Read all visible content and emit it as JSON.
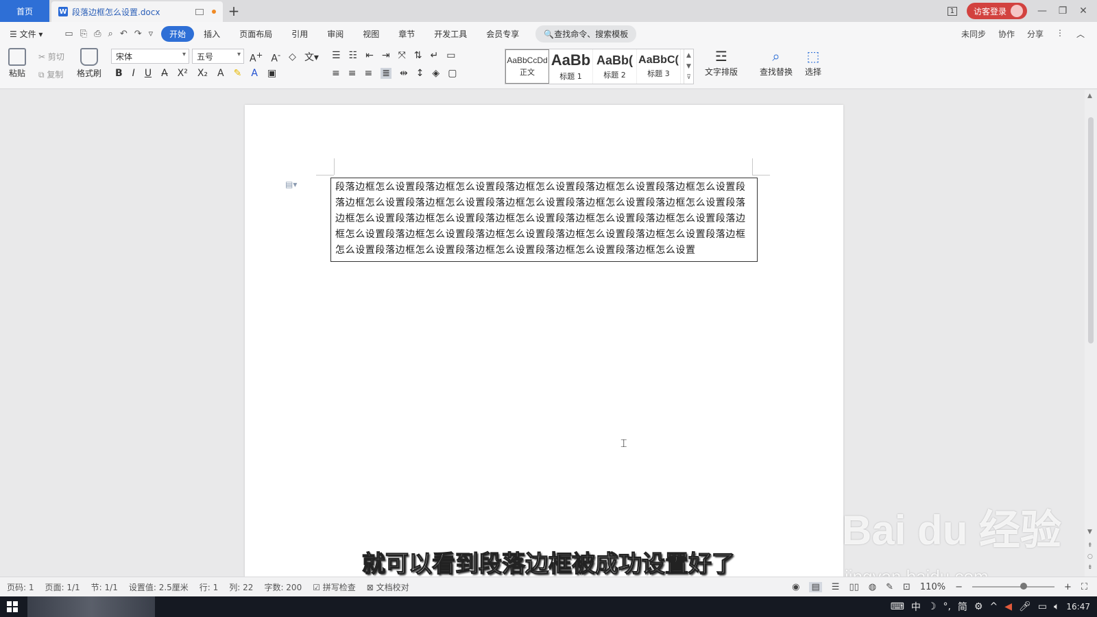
{
  "titlebar": {
    "home_tab": "首页",
    "doc_tab": "段落边框怎么设置.docx",
    "doc_icon_letter": "W",
    "new_tab": "+",
    "page_indicator": "1",
    "visitor_login": "访客登录",
    "minimize": "—",
    "restore": "❐",
    "close": "✕"
  },
  "menubar": {
    "file": "☰ 文件 ▾",
    "tabs": [
      "开始",
      "插入",
      "页面布局",
      "引用",
      "审阅",
      "视图",
      "章节",
      "开发工具",
      "会员专享"
    ],
    "search": "🔍查找命令、搜索模板",
    "unsynced": "未同步",
    "collab": "协作",
    "share": "分享"
  },
  "ribbon": {
    "paste": "粘贴",
    "cut": "剪切",
    "copy": "复制",
    "format_painter": "格式刷",
    "font_name": "宋体",
    "font_size": "五号",
    "styles": [
      {
        "sample": "AaBbCcDd",
        "name": "正文"
      },
      {
        "sample": "AaBb",
        "name": "标题 1"
      },
      {
        "sample": "AaBb(",
        "name": "标题 2"
      },
      {
        "sample": "AaBbC(",
        "name": "标题 3"
      }
    ],
    "text_layout": "文字排版",
    "find_replace": "查找替换",
    "select": "选择"
  },
  "document": {
    "paragraph": "段落边框怎么设置段落边框怎么设置段落边框怎么设置段落边框怎么设置段落边框怎么设置段落边框怎么设置段落边框怎么设置段落边框怎么设置段落边框怎么设置段落边框怎么设置段落边框怎么设置段落边框怎么设置段落边框怎么设置段落边框怎么设置段落边框怎么设置段落边框怎么设置段落边框怎么设置段落边框怎么设置段落边框怎么设置段落边框怎么设置段落边框怎么设置段落边框怎么设置段落边框怎么设置段落边框怎么设置段落边框怎么设置"
  },
  "overlay": {
    "subtitle": "就可以看到段落边框被成功设置好了",
    "watermark": "Bai du 经验",
    "watermark_url": "jingyan.baidu.com"
  },
  "statusbar": {
    "page_no": "页码: 1",
    "pages": "页面: 1/1",
    "section": "节: 1/1",
    "setting": "设置值: 2.5厘米",
    "row": "行: 1",
    "col": "列: 22",
    "words": "字数: 200",
    "spell": "拼写检查",
    "proof": "文档校对",
    "zoom": "110%"
  },
  "taskbar": {
    "ime": "中",
    "ime2": "简",
    "clock": "16:47"
  }
}
